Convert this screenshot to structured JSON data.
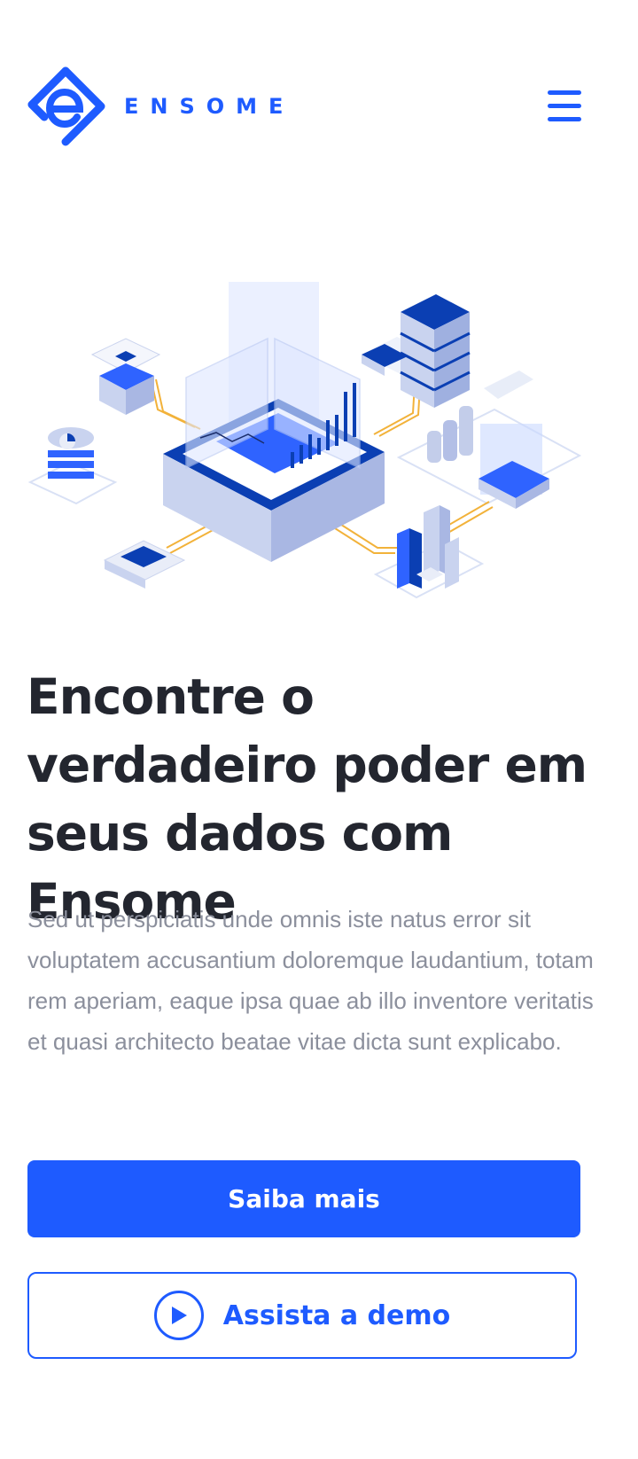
{
  "brand": {
    "name": "ENSOME",
    "accent_color": "#1e5bff",
    "logo_icon": "ensome-logo-icon"
  },
  "nav": {
    "menu_icon": "hamburger-menu-icon"
  },
  "hero": {
    "illustration": "isometric-data-platform-illustration",
    "headline": "Encontre o verdadeiro poder em seus dados com Ensome",
    "description": "Sed ut perspiciatis unde omnis iste natus error sit voluptatem accusantium doloremque laudantium, totam rem aperiam, eaque ipsa quae ab illo inventore veritatis et quasi architecto beatae vitae dicta sunt explicabo."
  },
  "actions": {
    "primary_label": "Saiba mais",
    "demo_label": "Assista a demo",
    "demo_icon": "play-icon"
  },
  "colors": {
    "heading": "#23262f",
    "body_text": "#8b8f9c",
    "primary": "#1e5bff",
    "illustration_dark": "#0b3fb3",
    "connector": "#f2b23a"
  }
}
